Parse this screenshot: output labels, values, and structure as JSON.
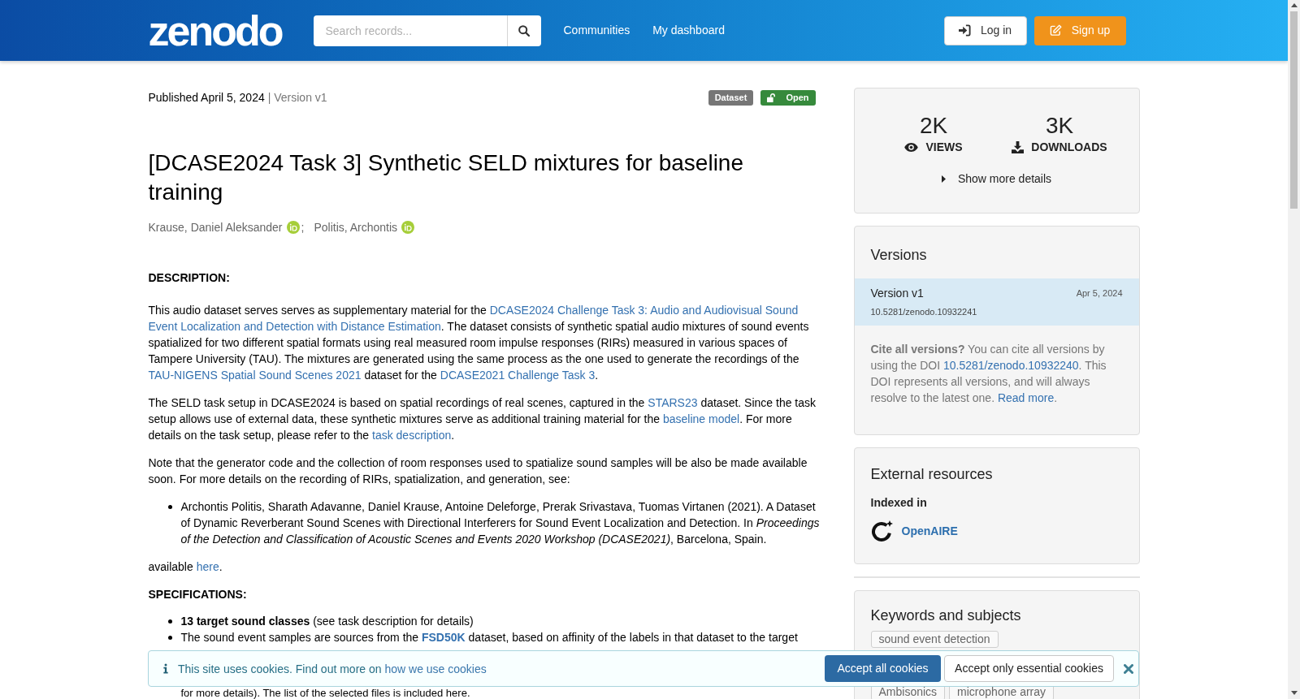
{
  "header": {
    "logo": "zenodo",
    "search": {
      "placeholder": "Search records..."
    },
    "nav": [
      {
        "label": "Communities"
      },
      {
        "label": "My dashboard"
      }
    ],
    "buttons": [
      {
        "kind": "login",
        "label": "Log in"
      },
      {
        "kind": "signup",
        "label": "Sign up"
      }
    ]
  },
  "record": {
    "published": "Published April 5, 2024",
    "version": "| Version v1",
    "badges": [
      {
        "kind": "type",
        "label": "Dataset"
      },
      {
        "kind": "access",
        "label": "Open"
      }
    ],
    "title": "[DCASE2024 Task 3] Synthetic SELD mixtures for baseline training",
    "authors": [
      {
        "name": "Krause, Daniel Aleksander",
        "separator": ";"
      },
      {
        "name": "Politis, Archontis"
      }
    ]
  },
  "description": {
    "heading": "DESCRIPTION:",
    "blocks": [
      {
        "kind": "paragraph",
        "segments": [
          {
            "kind": "text",
            "text": "This audio dataset serves serves as supplementary material for the "
          },
          {
            "kind": "link",
            "text": "DCASE2024 Challenge Task 3: Audio and Audiovisual Sound"
          },
          {
            "kind": "link",
            "text": "Event Localization and Detection with Distance Estimation"
          },
          {
            "kind": "text",
            "text": ". The dataset consists of synthetic spatial audio mixtures of sound events spatialized for two different spatial formats using real measured room impulse responses (RIRs) measured in various spaces of Tampere University (TAU). The mixtures are generated using the same process as the one used to generate the recordings of the "
          },
          {
            "kind": "link",
            "text": "TAU-NIGENS Spatial Sound Scenes 2021"
          },
          {
            "kind": "text",
            "text": " dataset for the "
          },
          {
            "kind": "link",
            "text": "DCASE2021 Challenge Task 3"
          },
          {
            "kind": "text",
            "text": "."
          }
        ]
      },
      {
        "kind": "paragraph",
        "segments": [
          {
            "kind": "text",
            "text": "The SELD task setup in DCASE2024 is based on spatial recordings of real scenes, captured in the "
          },
          {
            "kind": "link",
            "text": "STARS23"
          },
          {
            "kind": "text",
            "text": " dataset. Since the task setup allows use of external data, these synthetic mixtures serve as additional training material for the "
          },
          {
            "kind": "link",
            "text": "baseline model"
          },
          {
            "kind": "text",
            "text": ". For more details on the task setup, please refer to the "
          },
          {
            "kind": "link",
            "text": "task description"
          },
          {
            "kind": "text",
            "text": "."
          }
        ]
      },
      {
        "kind": "paragraph",
        "segments": [
          {
            "kind": "text",
            "text": "Note that the generator code and the collection of room responses used to spatialize sound samples will be also be made available soon. For more details on the recording of RIRs, spatialization, and generation, see:"
          }
        ]
      },
      {
        "kind": "bullet",
        "segments": [
          {
            "kind": "text",
            "text": "Archontis Politis, Sharath Adavanne, Daniel Krause, Antoine Deleforge, Prerak Srivastava, Tuomas Virtanen (2021). A Dataset of Dynamic Reverberant Sound Scenes with Directional Interferers for Sound Event Localization and Detection. In *Proceedings of the Detection and Classification of Acoustic Scenes and Events 2020 Workshop (DCASE2021)*, Barcelona, Spain."
          }
        ]
      },
      {
        "kind": "paragraph",
        "segments": [
          {
            "kind": "text",
            "text": "available "
          },
          {
            "kind": "link",
            "text": "here"
          },
          {
            "kind": "text",
            "text": "."
          }
        ]
      }
    ]
  },
  "specifications": {
    "heading": "SPECIFICATIONS:",
    "blocks": [
      {
        "kind": "bullet",
        "segments": [
          {
            "kind": "text",
            "text": "**13 target sound classes** (see task description for details)"
          }
        ]
      },
      {
        "kind": "bullet",
        "segments": [
          {
            "kind": "text",
            "text": "The sound event samples are sources from the "
          },
          {
            "kind": "bold_link",
            "text": "FSD50K"
          },
          {
            "kind": "text",
            "text": " dataset, based on affinity of the labels in that dataset to the target"
          }
        ]
      },
      {
        "kind": "fragment",
        "segments": [
          {
            "kind": "text",
            "text": "for more details). The list of the selected files is included here."
          }
        ]
      }
    ]
  },
  "stats": {
    "items": [
      {
        "kind": "views",
        "value": "2K",
        "label": "VIEWS"
      },
      {
        "kind": "downloads",
        "value": "3K",
        "label": "DOWNLOADS"
      }
    ],
    "details_toggle": {
      "label": "Show more details",
      "expanded": false
    }
  },
  "versions": {
    "title": "Versions",
    "items": [
      {
        "label": "Version v1",
        "date": "Apr 5, 2024",
        "doi": "10.5281/zenodo.10932241",
        "selected": true
      }
    ],
    "note": [
      {
        "kind": "text",
        "text": "**Cite all versions?** You can cite all versions by using the DOI "
      },
      {
        "kind": "link",
        "text": "10.5281/zenodo.10932240"
      },
      {
        "kind": "text",
        "text": ". This DOI represents all versions, and will always resolve to the latest one. "
      },
      {
        "kind": "link",
        "text": "Read more"
      },
      {
        "kind": "text",
        "text": "."
      }
    ]
  },
  "external_resources": {
    "title": "External resources",
    "subtitle": "Indexed in",
    "items": [
      {
        "label": "OpenAIRE"
      }
    ]
  },
  "keywords": {
    "title": "Keywords and subjects",
    "rows": [
      {
        "tags": [
          {
            "label": "sound event detection"
          }
        ]
      },
      {
        "tags": [
          {
            "label": "Ambisonics"
          },
          {
            "label": "microphone array"
          }
        ]
      }
    ]
  },
  "cookie_banner": {
    "message": [
      {
        "kind": "text",
        "text": "This site uses cookies. Find out more on "
      },
      {
        "kind": "link",
        "text": "how we use cookies"
      }
    ],
    "buttons": [
      {
        "kind": "primary",
        "label": "Accept all cookies"
      },
      {
        "kind": "secondary",
        "label": "Accept only essential cookies"
      }
    ]
  }
}
